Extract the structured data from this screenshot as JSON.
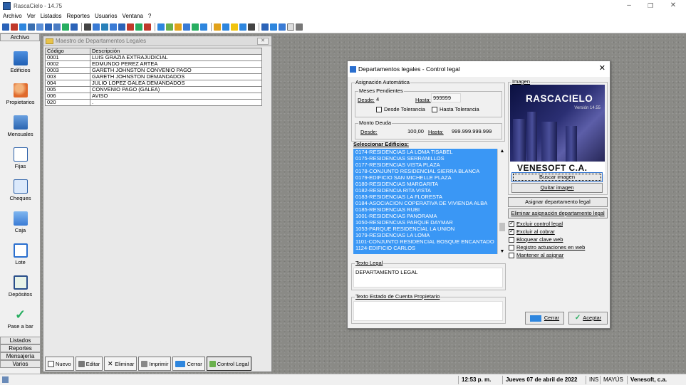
{
  "window": {
    "title": "RascaCielo - 14.75"
  },
  "menu": [
    "Archivo",
    "Ver",
    "Listados",
    "Reportes",
    "Usuarios",
    "Ventana",
    "?"
  ],
  "sidebar": {
    "top_tab": "Archivo",
    "items": [
      {
        "label": "Edificios",
        "icon": "building-icon"
      },
      {
        "label": "Propietarios",
        "icon": "people-icon"
      },
      {
        "label": "Mensuales",
        "icon": "calendar-icon"
      },
      {
        "label": "Fijas",
        "icon": "document-icon"
      },
      {
        "label": "Cheques",
        "icon": "edit-icon"
      },
      {
        "label": "Caja",
        "icon": "monitor-icon"
      },
      {
        "label": "Lote",
        "icon": "copy-icon"
      },
      {
        "label": "Depósitos",
        "icon": "checkbox-icon"
      },
      {
        "label": "Pase a bar",
        "icon": "check-icon"
      }
    ],
    "bottom_tabs": [
      "Listados",
      "Reportes",
      "Mensajería",
      "Varios"
    ]
  },
  "maestro": {
    "title": "Maestro de Departamentos Legales",
    "columns": [
      "Código",
      "Descripción"
    ],
    "rows": [
      [
        "0001",
        "LUIS GRAZIA EXTRAJUDICIAL"
      ],
      [
        "0002",
        "EDMUNDO PEREZ ARTEA"
      ],
      [
        "0003",
        "GARETH JOHNSTON CONVENIO PAGO"
      ],
      [
        "003",
        "GARETH JOHNSTON DEMANDADOS"
      ],
      [
        "004",
        "JULIO LOPEZ GALEA DEMANDADOS"
      ],
      [
        "005",
        "CONVENIO PAGO (GALEA)"
      ],
      [
        "006",
        "AVISO"
      ],
      [
        "020",
        "."
      ]
    ],
    "buttons": [
      "Nuevo",
      "Editar",
      "Eliminar",
      "Imprimir",
      "Cerrar",
      "Control Legal"
    ]
  },
  "dialog": {
    "title": "Departamentos legales - Control legal",
    "asignacion_label": "Asignación Automática",
    "meses_label": "Meses Pendientes",
    "desde_label": "Desde:",
    "desde_value": "4",
    "hasta_label": "Hasta:",
    "hasta_value": "999999",
    "desde_tolerancia": "Desde Tolerancia",
    "hasta_tolerancia": "Hasta Tolerancia",
    "monto_label": "Monto Deuda",
    "monto_desde_label": "Desde:",
    "monto_desde": "100,00",
    "monto_hasta_label": "Hasta:",
    "monto_hasta": "999.999.999.999",
    "edificios_label": "Seleccionar Edificios:",
    "edificios": [
      "0174-RESIDENCIAS LA LOMA       TISABEL",
      "0175-RESIDENCIAS SERRANILLOS",
      "0177-RESIDENCIAS VISTA PLAZA",
      "0178-CONJUNTO RESIDENCIAL SIERRA BLANCA",
      "0179-EDIFICIO SAN MICHELLE PLAZA",
      "0180-RESIDENCIAS MARGARITA",
      "0182-RESIDENCIA RITA VISTA",
      "0183-RESIDENCIAS LA FLORESTA",
      "0184-ASOCIACION COPERATIVA DE VIVIENDA ALBA",
      "0185-RESIDENCIAS RUBI",
      "1001-RESIDENCIAS PANORAMA",
      "1050-RESIDENCIAS PARQUE DAYMAR",
      "1053-PARQUE RESIDENCIAL LA UNION",
      "1079-RESIDENCIAS LA LOMA",
      "1101-CONJUNTO RESIDENCIAL BOSQUE ENCANTADO",
      "1124-EDIFICIO CARLOS"
    ],
    "texto_legal_label": "Texto Legal",
    "texto_legal": "DEPARTAMENTO LEGAL",
    "texto_estado_label": "Texto Estado de Cuenta Propietario",
    "texto_estado": "",
    "imagen_label": "Imagen",
    "image_logo": "RASCACIELO",
    "image_version": "Versión 14.55",
    "image_company": "VENESOFT C.A.",
    "buscar_imagen": "Buscar imagen",
    "quitar_imagen": "Quitar imagen",
    "asignar": "Asignar departamento legal",
    "eliminar_asignacion": "Eliminar asignación departamento legal",
    "options": [
      {
        "label": "Excluir control legal",
        "checked": true
      },
      {
        "label": "Excluir al cobrar",
        "checked": true
      },
      {
        "label": "Bloquear clave web",
        "checked": false
      },
      {
        "label": "Registro actuaciones en web",
        "checked": false
      },
      {
        "label": "Mantener al asignar",
        "checked": false
      }
    ],
    "cerrar": "Cerrar",
    "aceptar": "Aceptar"
  },
  "status": {
    "time": "12:53 p. m.",
    "date": "Jueves 07 de abril de 2022",
    "ins": "INS",
    "mayus": "MAYÚS",
    "company": "Venesoft, c.a."
  }
}
